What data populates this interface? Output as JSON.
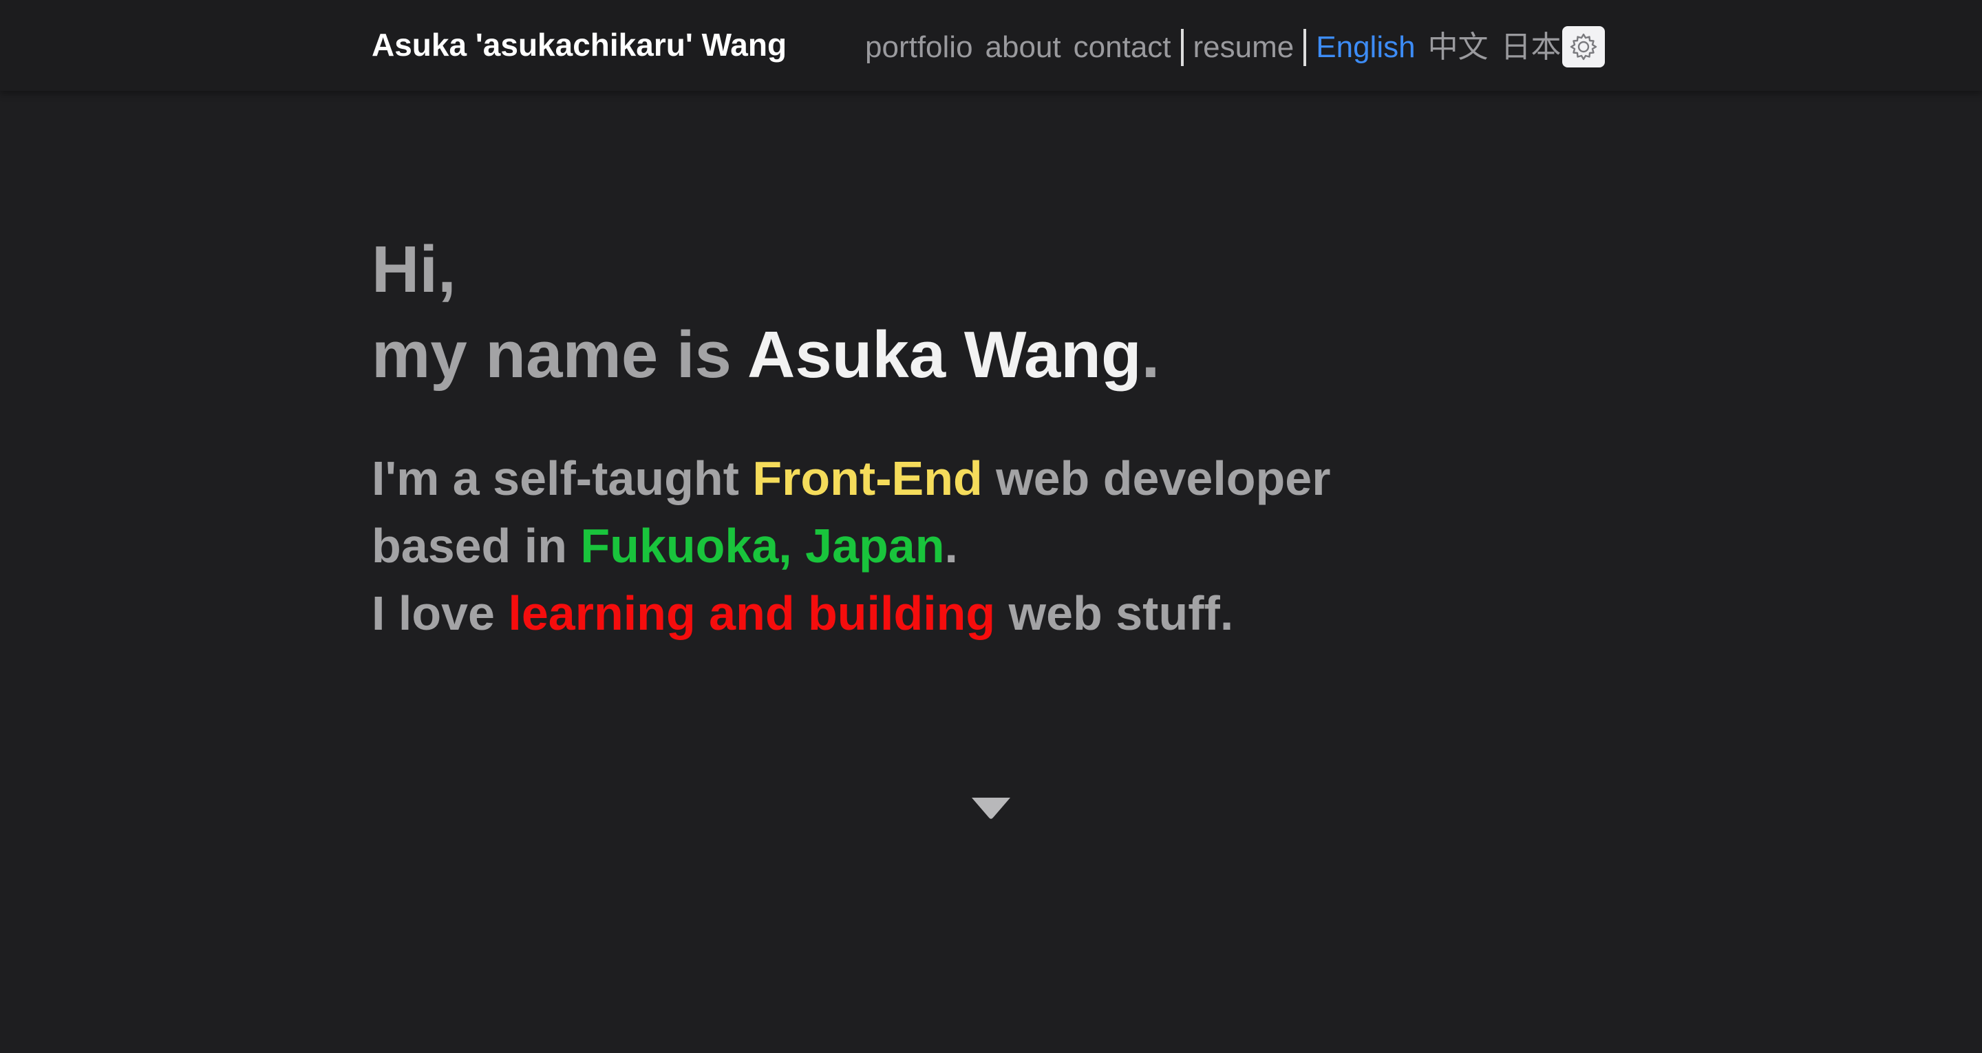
{
  "header": {
    "brand": "Asuka 'asukachikaru' Wang",
    "nav": {
      "portfolio": "portfolio",
      "about": "about",
      "contact": "contact",
      "resume": "resume"
    },
    "languages": {
      "english": "English",
      "chinese": "中文",
      "japanese": "日本語"
    },
    "theme_toggle_icon": "sun-gear-icon"
  },
  "hero": {
    "greeting": "Hi,",
    "name_prefix": "my name is ",
    "name": "Asuka Wang",
    "name_suffix": ".",
    "line1_prefix": "I'm a self-taught ",
    "line1_highlight": "Front-End",
    "line1_suffix": " web developer",
    "line2_prefix": "based in ",
    "line2_highlight": "Fukuoka, Japan",
    "line2_suffix": ".",
    "line3_prefix": "I love ",
    "line3_highlight": "learning and building",
    "line3_suffix": " web stuff."
  },
  "scroll_icon": "caret-down-icon",
  "colors": {
    "background": "#1e1e20",
    "header_bg": "#1c1c1e",
    "muted_text": "#a3a3a5",
    "active_language": "#3d8cf6",
    "yellow_highlight": "#f5dc5b",
    "green_highlight": "#19c43c",
    "red_highlight": "#f50d0d"
  }
}
